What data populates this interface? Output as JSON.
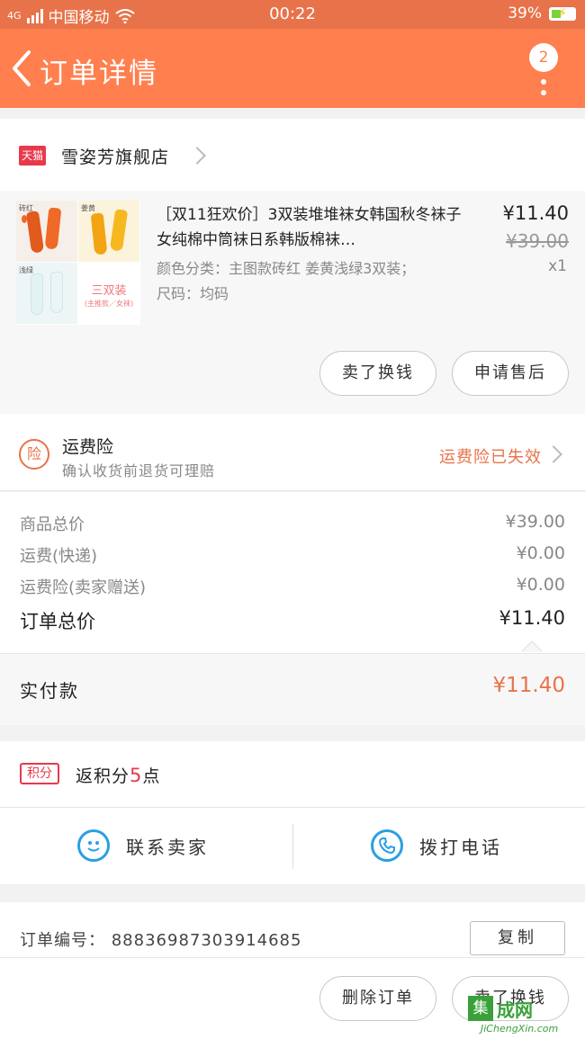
{
  "status_bar": {
    "network": "4G",
    "carrier": "中国移动",
    "time": "00:22",
    "battery": "39%"
  },
  "header": {
    "title": "订单详情",
    "badge_count": "2"
  },
  "shop": {
    "platform_badge": "天猫",
    "name": "雪姿芳旗舰店"
  },
  "product": {
    "thumb_tag_1": "砖红",
    "thumb_tag_2": "姜黄",
    "thumb_tag_3": "浅绿",
    "thumb_promo": "三双装",
    "thumb_promo_sub": "(主推款／女袜)",
    "title": "［双11狂欢价］3双装堆堆袜女韩国秋冬袜子女纯棉中筒袜日系韩版棉袜…",
    "spec_color": "颜色分类：主图款砖红 姜黄浅绿3双装；",
    "spec_size": "尺码：均码",
    "price": "¥11.40",
    "original_price": "¥39.00",
    "quantity": "x1",
    "buttons": [
      "卖了换钱",
      "申请售后"
    ]
  },
  "insurance": {
    "icon_text": "险",
    "title": "运费险",
    "subtitle": "确认收货前退货可理赔",
    "status": "运费险已失效"
  },
  "costs": {
    "rows": [
      {
        "label": "商品总价",
        "value": "¥39.00"
      },
      {
        "label": "运费(快递)",
        "value": "¥0.00"
      },
      {
        "label": "运费险(卖家赠送)",
        "value": "¥0.00"
      }
    ],
    "total_label": "订单总价",
    "total_value": "¥11.40"
  },
  "paid": {
    "label": "实付款",
    "value": "¥11.40"
  },
  "points": {
    "tag": "积分",
    "prefix": "返积分",
    "amount": "5",
    "suffix": "点"
  },
  "contact": {
    "seller": "联系卖家",
    "phone": "拨打电话"
  },
  "order": {
    "label": "订单编号：",
    "number": "8883698730391468​5",
    "copy": "复制"
  },
  "footer": {
    "delete": "删除订单",
    "sell": "卖了换钱"
  },
  "watermark": {
    "box": "集",
    "text": "成网",
    "domain": "JiChengXin.com"
  },
  "colors": {
    "brand": "#ff7f4f",
    "accent_text": "#e8734a",
    "points": "#e8394b",
    "contact_blue": "#2a9fe3"
  }
}
